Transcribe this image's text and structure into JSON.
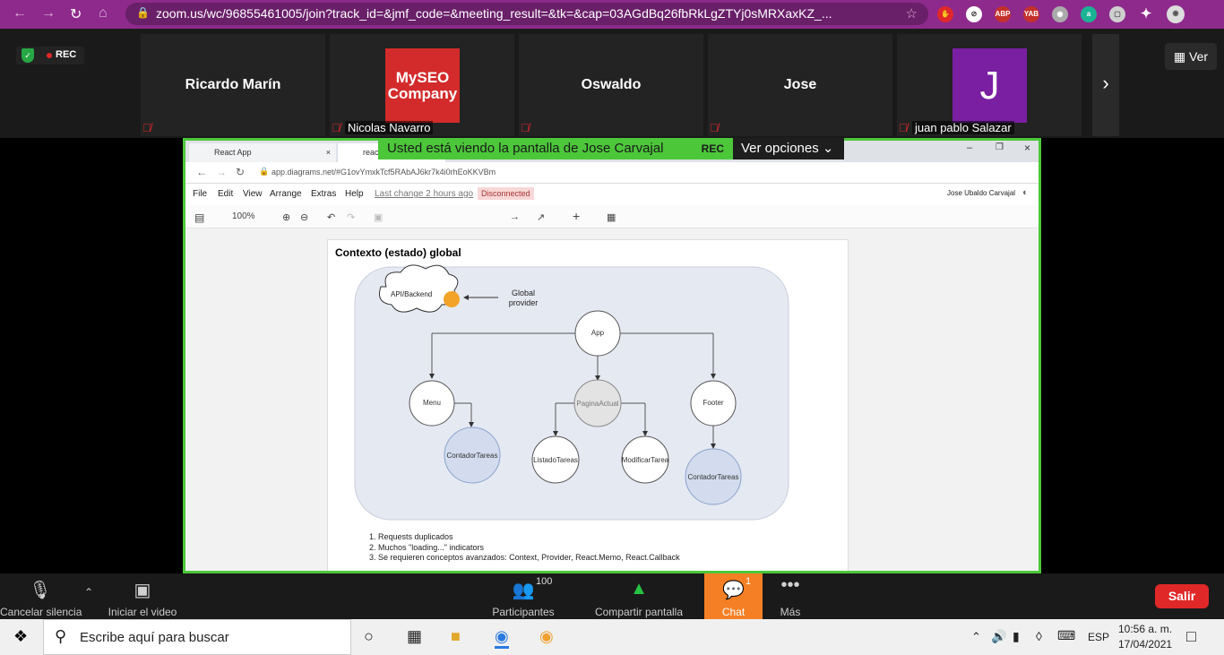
{
  "browser": {
    "url": "zoom.us/wc/96855461005/join?track_id=&jmf_code=&meeting_result=&tk=&cap=03AGdBq26fbRkLgZTYj0sMRXaxKZ_...",
    "extensions": [
      "ABP",
      "YAB"
    ]
  },
  "strip": {
    "rec_label": "REC",
    "ver_label": "Ver",
    "participants": [
      {
        "name": "Ricardo Marín",
        "label": ""
      },
      {
        "name": "",
        "label": "Nicolas Navarro",
        "logo": "MySEO Company"
      },
      {
        "name": "Oswaldo",
        "label": ""
      },
      {
        "name": "Jose",
        "label": ""
      },
      {
        "name": "",
        "label": "juan pablo Salazar",
        "avatar_letter": "J"
      }
    ]
  },
  "share": {
    "banner": "Usted está viendo la pantalla de Jose Carvajal",
    "banner_rec": "REC",
    "options": "Ver opciones",
    "tab1": "React App",
    "tab2": "react",
    "url": "app.diagrams.net/#G1ovYmxkTcf5RAbAJ6kr7k4i0rhEoKKVBm",
    "menu": [
      "File",
      "Edit",
      "View",
      "Arrange",
      "Extras",
      "Help"
    ],
    "last_change": "Last change 2 hours ago",
    "status": "Disconnected",
    "user": "Jose Ubaldo Carvajal",
    "zoom": "100%",
    "diagram_title": "Contexto (estado) global",
    "nodes": {
      "api": "API/Backend",
      "provider": "Global provider",
      "app": "App",
      "menu": "Menu",
      "pagina": "PaginaActual",
      "footer": "Footer",
      "contador1": "ContadorTareas",
      "listado": "ListadoTareas",
      "modificar": "ModificarTarea",
      "contador2": "ContadorTareas"
    },
    "notes": [
      "Requests duplicados",
      "Muchos \"loading...\" indicators",
      "Se requieren conceptos avanzados: Context, Provider, React.Memo, React.Callback"
    ]
  },
  "controls": {
    "mute": "Cancelar silencia",
    "video": "Iniciar el video",
    "participants": "Participantes",
    "participants_count": "100",
    "share": "Compartir pantalla",
    "chat": "Chat",
    "chat_count": "1",
    "more": "Más",
    "leave": "Salir"
  },
  "taskbar": {
    "search": "Escribe aquí para buscar",
    "lang": "ESP",
    "time": "10:56 a. m.",
    "date": "17/04/2021"
  },
  "colors": {
    "zoom_green": "#4cc73a",
    "chat_orange": "#f57f24",
    "leave_red": "#e02828",
    "browser_purple": "#8e2a8c"
  }
}
